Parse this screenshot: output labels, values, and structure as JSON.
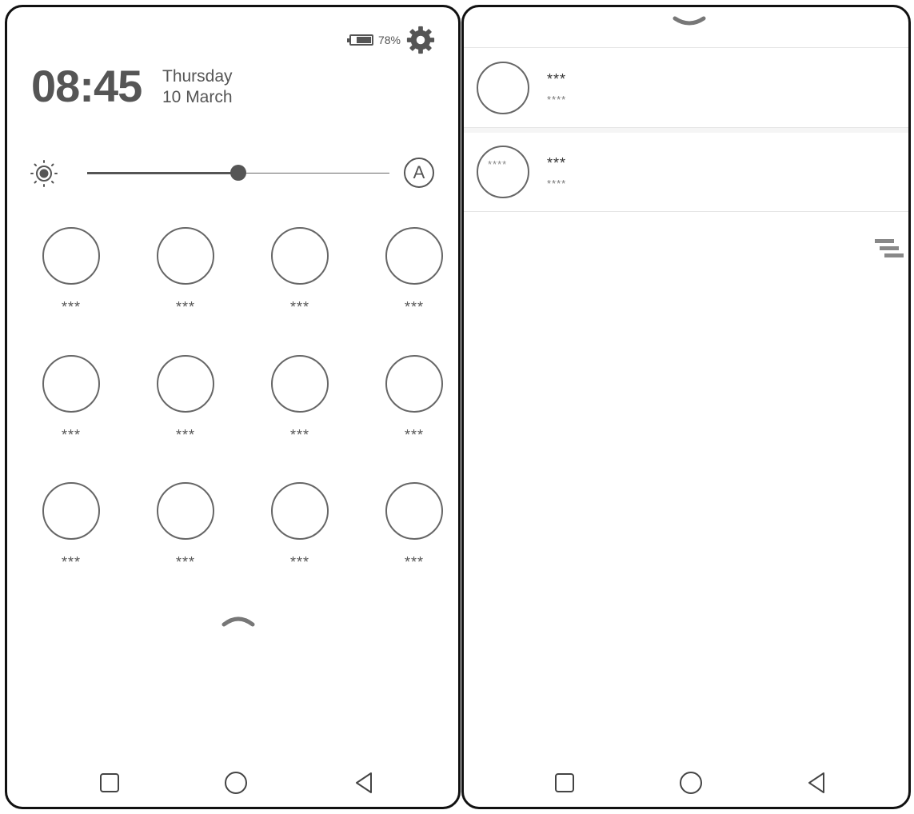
{
  "lock_screen": {
    "battery_percent_text": "78%",
    "battery_level": 0.78,
    "time": "08:45",
    "day": "Thursday",
    "date": "10 March",
    "brightness_level": 0.5,
    "auto_brightness_label": "A",
    "toggles": [
      {
        "label": "***"
      },
      {
        "label": "***"
      },
      {
        "label": "***"
      },
      {
        "label": "***"
      },
      {
        "label": "***"
      },
      {
        "label": "***"
      },
      {
        "label": "***"
      },
      {
        "label": "***"
      },
      {
        "label": "***"
      },
      {
        "label": "***"
      },
      {
        "label": "***"
      },
      {
        "label": "***"
      }
    ]
  },
  "notifications": {
    "items": [
      {
        "title": "***",
        "subtitle": "****",
        "time": ""
      },
      {
        "title": "***",
        "subtitle": "****",
        "time": "****"
      }
    ]
  },
  "icons": {
    "settings": "gear-icon",
    "brightness": "sun-icon",
    "expand": "chevron-up-icon",
    "collapse": "chevron-down-icon",
    "clear_all": "clear-all-icon",
    "nav": [
      "recents-square-icon",
      "home-circle-icon",
      "back-triangle-icon"
    ]
  },
  "colors": {
    "foreground": "#555555",
    "background": "#ffffff",
    "divider": "#e6e6e6"
  }
}
